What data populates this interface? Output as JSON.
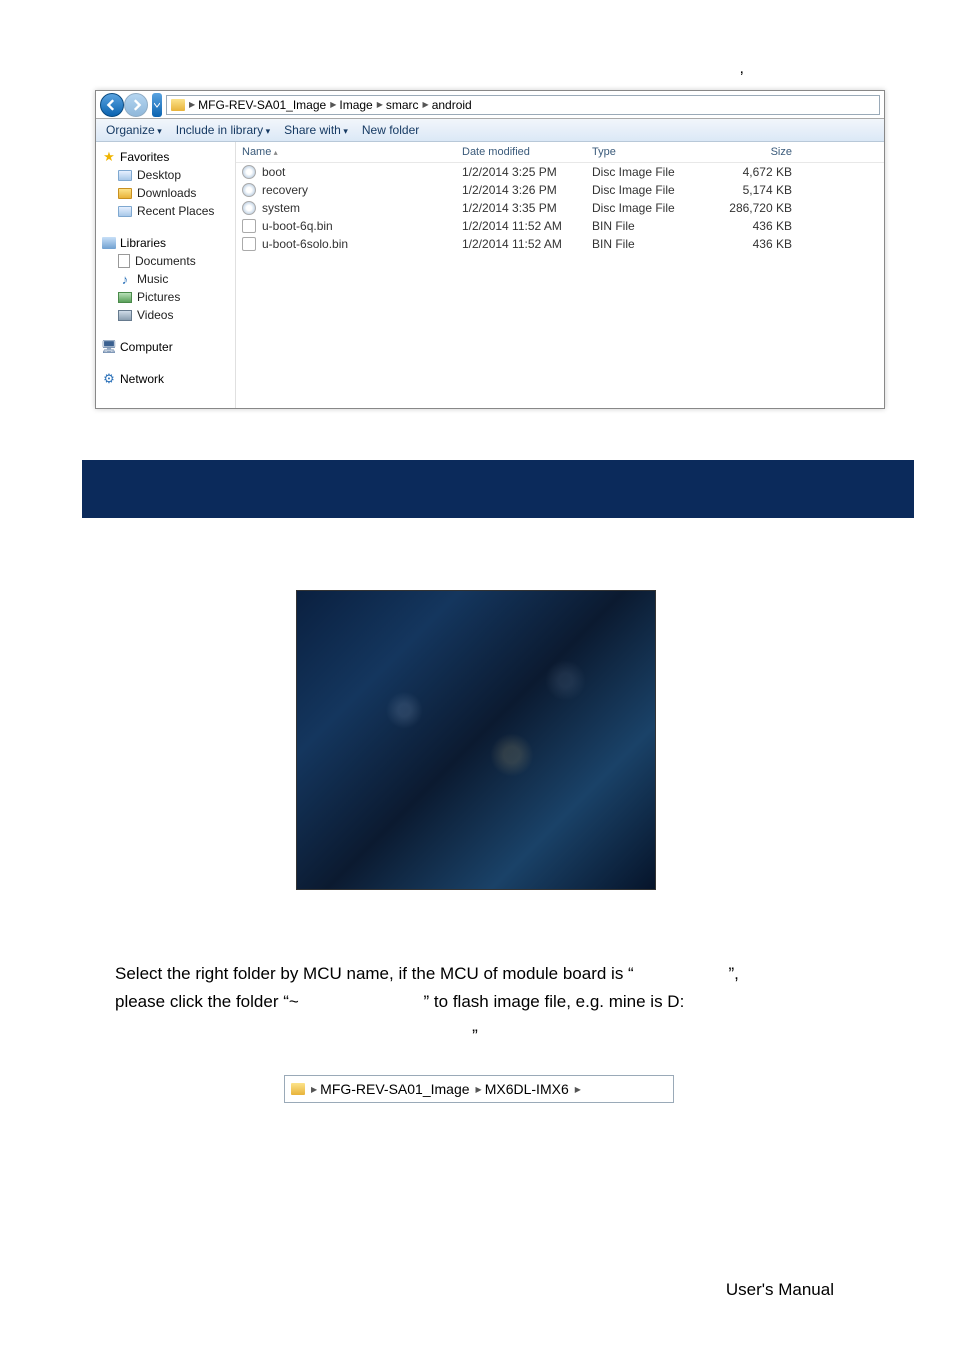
{
  "top_comma": ",",
  "explorer": {
    "breadcrumb": [
      "MFG-REV-SA01_Image",
      "Image",
      "smarc",
      "android"
    ],
    "toolbar": {
      "organize": "Organize",
      "include": "Include in library",
      "share": "Share with",
      "newfolder": "New folder"
    },
    "nav": {
      "favorites": "Favorites",
      "desktop": "Desktop",
      "downloads": "Downloads",
      "recent": "Recent Places",
      "libraries": "Libraries",
      "documents": "Documents",
      "music": "Music",
      "pictures": "Pictures",
      "videos": "Videos",
      "computer": "Computer",
      "network": "Network"
    },
    "columns": {
      "name": "Name",
      "date": "Date modified",
      "type": "Type",
      "size": "Size"
    },
    "files": [
      {
        "name": "boot",
        "date": "1/2/2014 3:25 PM",
        "type": "Disc Image File",
        "size": "4,672 KB",
        "kind": "disc"
      },
      {
        "name": "recovery",
        "date": "1/2/2014 3:26 PM",
        "type": "Disc Image File",
        "size": "5,174 KB",
        "kind": "disc"
      },
      {
        "name": "system",
        "date": "1/2/2014 3:35 PM",
        "type": "Disc Image File",
        "size": "286,720 KB",
        "kind": "disc"
      },
      {
        "name": "u-boot-6q.bin",
        "date": "1/2/2014 11:52 AM",
        "type": "BIN File",
        "size": "436 KB",
        "kind": "bin"
      },
      {
        "name": "u-boot-6solo.bin",
        "date": "1/2/2014 11:52 AM",
        "type": "BIN File",
        "size": "436 KB",
        "kind": "bin"
      }
    ]
  },
  "body_text": {
    "line1a": "Select the right folder by MCU name, if the MCU of module board is “",
    "line1b": "”,",
    "line2a": "please click the folder “~",
    "line2b": "” to flash image file, e.g. mine is D:",
    "line3": "”"
  },
  "crumb2": [
    "MFG-REV-SA01_Image",
    "MX6DL-IMX6"
  ],
  "footer": "User's  Manual",
  "page": ""
}
